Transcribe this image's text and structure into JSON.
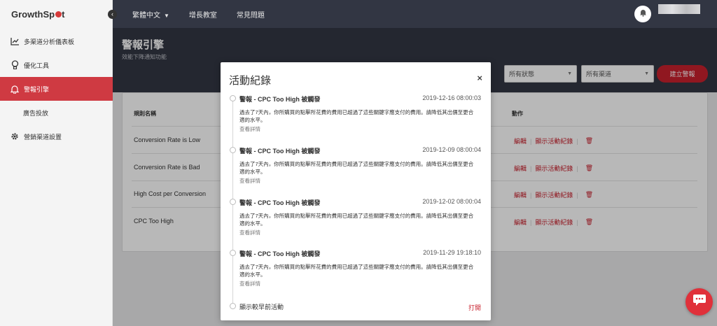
{
  "app": {
    "logo_prefix": "GrowthSp",
    "logo_suffix": "t"
  },
  "sidebar": {
    "collapse_glyph": "‹",
    "items": [
      {
        "label": "多渠道分析儀表板",
        "icon": "chart-line-icon"
      },
      {
        "label": "優化工具",
        "icon": "lightbulb-icon"
      },
      {
        "label": "警報引擎",
        "icon": "bell-icon",
        "active": true
      },
      {
        "label": "廣告投放",
        "icon": "none"
      },
      {
        "label": "營銷渠道設置",
        "icon": "gear-icon"
      }
    ]
  },
  "topbar": {
    "language": "繁體中文",
    "links": [
      "增長教室",
      "常見問題"
    ]
  },
  "header": {
    "title": "警報引擎",
    "subtitle": "效能下降通知功能",
    "status_select": "所有狀態",
    "channel_select": "所有渠道",
    "create_button": "建立警報"
  },
  "table": {
    "headers": {
      "name": "規則名稱",
      "actions": "動作"
    },
    "rows": [
      {
        "name": "Conversion Rate is Low"
      },
      {
        "name": "Conversion Rate is Bad"
      },
      {
        "name": "High Cost per Conversion"
      },
      {
        "name": "CPC Too High"
      }
    ],
    "action_edit": "編輯",
    "action_log": "顯示活動紀錄"
  },
  "modal": {
    "title": "活動紀錄",
    "close": "×",
    "entries": [
      {
        "title": "警報 - CPC Too High 被觸發",
        "date": "2019-12-16 08:00:03",
        "desc": "過去了7天內，你所購買的點擊所花費的費用已超過了這些關鍵字應支付的費用。請降低其出價至更合適的水平。",
        "link": "查看詳情"
      },
      {
        "title": "警報 - CPC Too High 被觸發",
        "date": "2019-12-09 08:00:04",
        "desc": "過去了7天內，你所購買的點擊所花費的費用已超過了這些關鍵字應支付的費用。請降低其出價至更合適的水平。",
        "link": "查看詳情"
      },
      {
        "title": "警報 - CPC Too High 被觸發",
        "date": "2019-12-02 08:00:04",
        "desc": "過去了7天內，你所購買的點擊所花費的費用已超過了這些關鍵字應支付的費用。請降低其出價至更合適的水平。",
        "link": "查看詳情"
      },
      {
        "title": "警報 - CPC Too High 被觸發",
        "date": "2019-11-29 19:18:10",
        "desc": "過去了7天內，你所購買的點擊所花費的費用已超過了這些關鍵字應支付的費用。請降低其出價至更合適的水平。",
        "link": "查看詳情"
      }
    ],
    "earlier": "顯示較早前活動",
    "open": "打開"
  },
  "colors": {
    "accent": "#c8202d",
    "topbar": "#323643",
    "sidebar_active": "#cf3a42"
  }
}
